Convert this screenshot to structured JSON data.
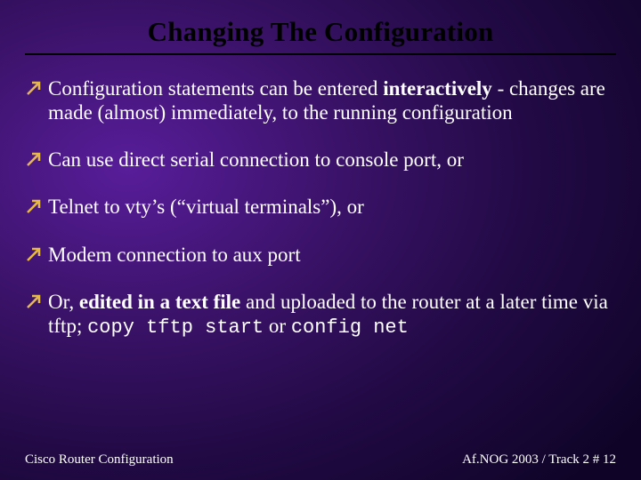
{
  "title": "Changing The Configuration",
  "bullets": [
    {
      "segments": [
        {
          "text": "Configuration statements can be entered "
        },
        {
          "text": "interactively",
          "bold": true
        },
        {
          "text": " - changes are made (almost) immediately, to the running configuration"
        }
      ]
    },
    {
      "segments": [
        {
          "text": "Can use direct serial connection to console port, or"
        }
      ]
    },
    {
      "segments": [
        {
          "text": "Telnet to vty’s (“virtual terminals”), or"
        }
      ]
    },
    {
      "segments": [
        {
          "text": "Modem connection to aux port"
        }
      ]
    },
    {
      "segments": [
        {
          "text": "Or, "
        },
        {
          "text": "edited in a text file",
          "bold": true
        },
        {
          "text": " and uploaded to the router at a later time via tftp; "
        },
        {
          "text": "copy tftp start",
          "mono": true
        },
        {
          "text": " or "
        },
        {
          "text": "config net",
          "mono": true
        }
      ]
    }
  ],
  "footer": {
    "left": "Cisco Router Configuration",
    "right": "Af.NOG 2003 / Track 2  # 12"
  },
  "icons": {
    "bullet_arrow": "arrow-upper-right"
  }
}
